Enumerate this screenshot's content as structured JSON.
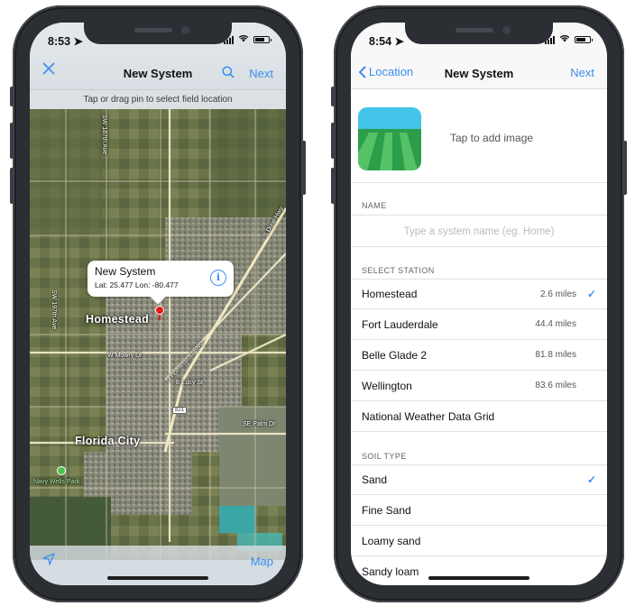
{
  "left": {
    "status_time": "8:53",
    "nav": {
      "close_label": "✕",
      "title": "New System",
      "next_label": "Next"
    },
    "hint": "Tap or drag pin to select field location",
    "callout": {
      "title": "New System",
      "coords": "Lat: 25.477 Lon: -80.477"
    },
    "map_labels": {
      "homestead": "Homestead",
      "florida_city": "Florida City",
      "w_mowry": "W Mowry Dr",
      "e_lucy": "E Lucy St",
      "se_palm": "SE Palm Dr",
      "sw_ave": "SW 187th Ave",
      "sw_ave2": "SW 197th Ave",
      "homestead_blvd": "N Homestead Blvd",
      "route": "821",
      "park": "Navy Wells Park",
      "sd_road": "S Dixie Hwy"
    },
    "toolbar": {
      "map_label": "Map"
    }
  },
  "right": {
    "status_time": "8:54",
    "nav": {
      "back_label": "Location",
      "title": "New System",
      "next_label": "Next"
    },
    "tap_image": "Tap to add image",
    "name_header": "NAME",
    "name_placeholder": "Type a system name (eg. Home)",
    "station_header": "SELECT STATION",
    "stations": [
      {
        "name": "Homestead",
        "distance": "2.6 miles",
        "selected": true
      },
      {
        "name": "Fort Lauderdale",
        "distance": "44.4 miles",
        "selected": false
      },
      {
        "name": "Belle Glade 2",
        "distance": "81.8 miles",
        "selected": false
      },
      {
        "name": "Wellington",
        "distance": "83.6 miles",
        "selected": false
      },
      {
        "name": "National Weather Data Grid",
        "distance": "",
        "selected": false
      }
    ],
    "soil_header": "SOIL TYPE",
    "soils": [
      {
        "name": "Sand",
        "selected": true
      },
      {
        "name": "Fine Sand",
        "selected": false
      },
      {
        "name": "Loamy sand",
        "selected": false
      },
      {
        "name": "Sandy loam",
        "selected": false
      }
    ]
  },
  "colors": {
    "accent": "#3b8ff0",
    "pin": "#e41b17"
  }
}
